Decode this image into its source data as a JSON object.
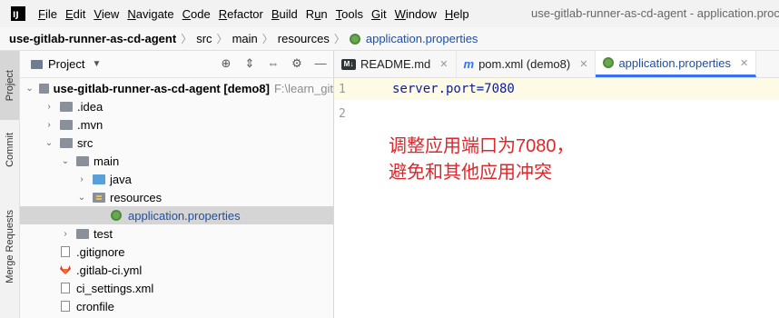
{
  "menubar": {
    "logo": "IJ",
    "items": [
      "File",
      "Edit",
      "View",
      "Navigate",
      "Code",
      "Refactor",
      "Build",
      "Run",
      "Tools",
      "Git",
      "Window",
      "Help"
    ],
    "mnemonics": [
      "F",
      "E",
      "V",
      "N",
      "C",
      "R",
      "B",
      "u",
      "T",
      "G",
      "W",
      "H"
    ],
    "window_title": "use-gitlab-runner-as-cd-agent - application.proc"
  },
  "breadcrumb": {
    "items": [
      "use-gitlab-runner-as-cd-agent",
      "src",
      "main",
      "resources",
      "application.properties"
    ]
  },
  "toolstrip": {
    "tabs": [
      "Project",
      "Commit",
      "Merge Requests"
    ]
  },
  "project_panel": {
    "title": "Project",
    "tree": [
      {
        "label": "use-gitlab-runner-as-cd-agent [demo8]",
        "path": "F:\\learn_git",
        "depth": 0,
        "arrow": "down",
        "icon": "folder"
      },
      {
        "label": ".idea",
        "depth": 1,
        "arrow": "right",
        "icon": "folder"
      },
      {
        "label": ".mvn",
        "depth": 1,
        "arrow": "right",
        "icon": "folder"
      },
      {
        "label": "src",
        "depth": 1,
        "arrow": "down",
        "icon": "folder"
      },
      {
        "label": "main",
        "depth": 2,
        "arrow": "down",
        "icon": "folder"
      },
      {
        "label": "java",
        "depth": 3,
        "arrow": "right",
        "icon": "src-folder"
      },
      {
        "label": "resources",
        "depth": 3,
        "arrow": "down",
        "icon": "res-folder"
      },
      {
        "label": "application.properties",
        "depth": 4,
        "arrow": "",
        "icon": "props",
        "selected": true
      },
      {
        "label": "test",
        "depth": 2,
        "arrow": "right",
        "icon": "folder"
      },
      {
        "label": ".gitignore",
        "depth": 1,
        "arrow": "",
        "icon": "text"
      },
      {
        "label": ".gitlab-ci.yml",
        "depth": 1,
        "arrow": "",
        "icon": "gitlab"
      },
      {
        "label": "ci_settings.xml",
        "depth": 1,
        "arrow": "",
        "icon": "text"
      },
      {
        "label": "cronfile",
        "depth": 1,
        "arrow": "",
        "icon": "text"
      }
    ]
  },
  "editor": {
    "tabs": [
      {
        "label": "README.md",
        "icon": "md-icon"
      },
      {
        "label": "pom.xml (demo8)",
        "icon": "m-icon"
      },
      {
        "label": "application.properties",
        "icon": "props-icon",
        "active": true
      }
    ],
    "line_numbers": [
      "1",
      "2"
    ],
    "code_lines": [
      "server.port=7080",
      ""
    ],
    "annotation_lines": [
      "调整应用端口为7080，",
      "避免和其他应用冲突"
    ]
  },
  "colors": {
    "accent": "#3574f0",
    "annotation": "#e0262a",
    "current_line": "#fdfbe6",
    "selection": "#d5d5d5"
  }
}
